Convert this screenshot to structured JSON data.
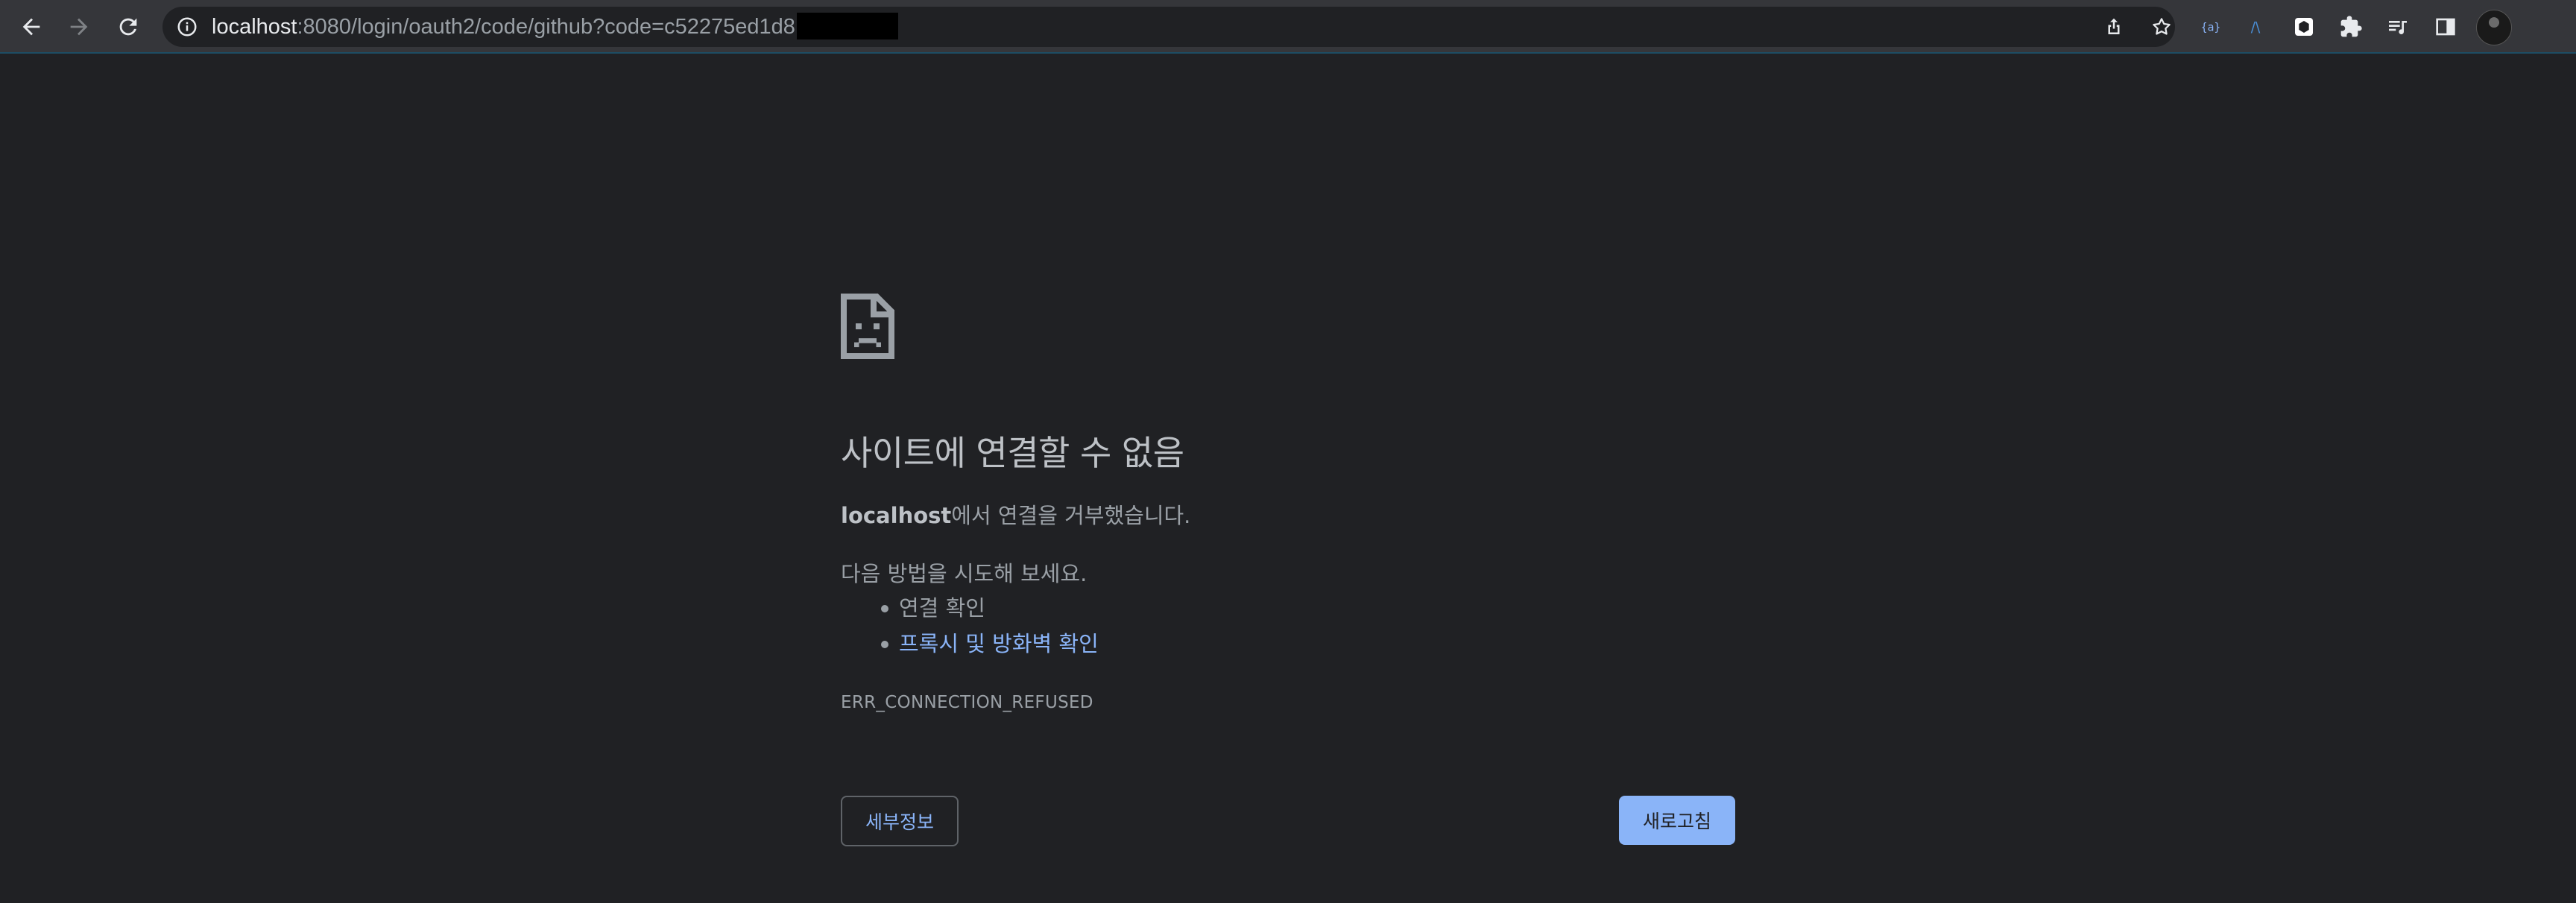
{
  "toolbar": {
    "url_host": "localhost",
    "url_rest": ":8080/login/oauth2/code/github?code=c52275ed1d8",
    "url_redacted": true
  },
  "icons": {
    "back": "arrow-back-icon",
    "forward": "arrow-forward-icon",
    "reload": "reload-icon",
    "site_info": "info-icon",
    "share": "share-icon",
    "bookmark": "star-icon",
    "extensions": [
      "braces-extension-icon",
      "lambda-extension-icon",
      "cube-extension-icon",
      "puzzle-icon",
      "reading-list-icon",
      "side-panel-icon"
    ],
    "sad_page": "sad-document-icon"
  },
  "error": {
    "title": "사이트에 연결할 수 없음",
    "host": "localhost",
    "summary_suffix": "에서 연결을 거부했습니다.",
    "try_label": "다음 방법을 시도해 보세요.",
    "suggestions": [
      "연결 확인",
      "프록시 및 방화벽 확인"
    ],
    "code": "ERR_CONNECTION_REFUSED",
    "details_button": "세부정보",
    "reload_button": "새로고침"
  },
  "colors": {
    "background": "#202124",
    "toolbar": "#35363a",
    "link": "#8ab4f8",
    "text": "#9aa0a6",
    "title": "#bdc1c6"
  }
}
